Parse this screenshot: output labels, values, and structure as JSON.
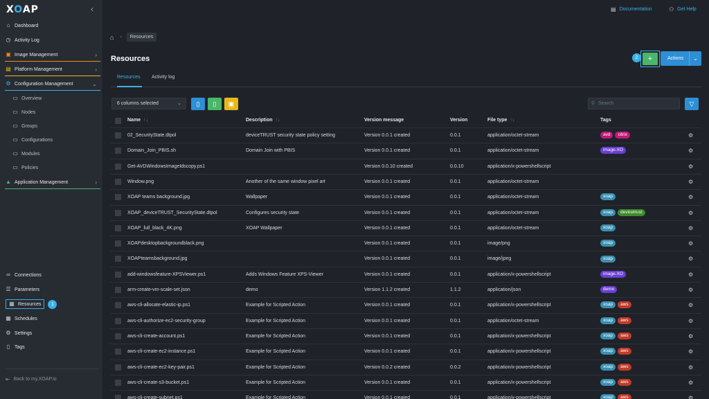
{
  "sidebar": {
    "logo": "XOAP",
    "items": [
      {
        "label": "Dashboard"
      },
      {
        "label": "Activity Log"
      },
      {
        "label": "Image Management"
      },
      {
        "label": "Platform Management"
      },
      {
        "label": "Configuration Management"
      },
      {
        "label": "Overview"
      },
      {
        "label": "Nodes"
      },
      {
        "label": "Groups"
      },
      {
        "label": "Configurations"
      },
      {
        "label": "Modules"
      },
      {
        "label": "Policies"
      },
      {
        "label": "Application Management"
      }
    ],
    "bottom": [
      {
        "label": "Connections"
      },
      {
        "label": "Parameters"
      },
      {
        "label": "Resources"
      },
      {
        "label": "Schedules"
      },
      {
        "label": "Settings"
      },
      {
        "label": "Tags"
      }
    ],
    "step_badge": "1",
    "back_link": "Back to my.XOAP.io",
    "colors": {
      "image": "#f08c1a",
      "platform": "#f0b61a",
      "config": "#3bb0e8",
      "app": "#4bb56a"
    }
  },
  "topbar": {
    "documentation": "Documentation",
    "help": "Get Help"
  },
  "breadcrumb": {
    "current": "Resources"
  },
  "page": {
    "title": "Resources",
    "step_badge": "2",
    "add_label": "+",
    "actions_label": "Actions",
    "tabs": [
      "Resources",
      "Activity log"
    ],
    "columns_selected": "6 columns selected",
    "search_placeholder": "Search"
  },
  "table": {
    "headers": [
      "Name",
      "Description",
      "Version message",
      "Version",
      "File type",
      "Tags"
    ],
    "rows": [
      {
        "name": "02_SecurityState.dtpol",
        "desc": "deviceTRUST security state policy setting",
        "msg": "Version 0.0.1 created",
        "ver": "0.0.1",
        "type": "application/octet-stream",
        "tags": [
          {
            "t": "avd",
            "c": "#c2187a"
          },
          {
            "t": "citrix",
            "c": "#c2187a"
          }
        ]
      },
      {
        "name": "Domain_Join_PBIS.sh",
        "desc": "Domain Join with PBIS",
        "msg": "Version 0.0.1 created",
        "ver": "0.0.1",
        "type": "application/octet-stream",
        "tags": [
          {
            "t": "image.XO",
            "c": "#6a3fd6"
          }
        ]
      },
      {
        "name": "Get-AVDWindowsImageIdscopy.ps1",
        "desc": "",
        "msg": "Version 0.0.10 created",
        "ver": "0.0.10",
        "type": "application/x-powershellscript",
        "tags": []
      },
      {
        "name": "Window.png",
        "desc": "Another of the same window pixel art",
        "msg": "Version 0.0.1 created",
        "ver": "0.0.1",
        "type": "application/octet-stream",
        "tags": []
      },
      {
        "name": "XOAP teams background.jpg",
        "desc": "Wallpaper",
        "msg": "Version 0.0.1 created",
        "ver": "0.0.1",
        "type": "application/octet-stream",
        "tags": [
          {
            "t": "xoap",
            "c": "#3a8fb0"
          }
        ]
      },
      {
        "name": "XOAP_deviceTRUST_SecurityState.dtpol",
        "desc": "Configures security state",
        "msg": "Version 0.0.1 created",
        "ver": "0.0.1",
        "type": "application/octet-stream",
        "tags": [
          {
            "t": "xoap",
            "c": "#3a8fb0"
          },
          {
            "t": "devicetrust",
            "c": "#3f8a2c"
          }
        ]
      },
      {
        "name": "XOAP_full_black_4K.png",
        "desc": "XOAP Wallpaper",
        "msg": "Version 0.0.1 created",
        "ver": "0.0.1",
        "type": "application/octet-stream",
        "tags": [
          {
            "t": "xoap",
            "c": "#3a8fb0"
          }
        ]
      },
      {
        "name": "XOAPdesktopbackgroundblack.png",
        "desc": "",
        "msg": "Version 0.0.1 created",
        "ver": "0.0.1",
        "type": "image/png",
        "tags": [
          {
            "t": "xoap",
            "c": "#3a8fb0"
          }
        ]
      },
      {
        "name": "XOAPteamsbackground.jpg",
        "desc": "",
        "msg": "Version 0.0.1 created",
        "ver": "0.0.1",
        "type": "image/jpeg",
        "tags": [
          {
            "t": "xoap",
            "c": "#3a8fb0"
          }
        ]
      },
      {
        "name": "add-windowsfeature-XPSViewer.ps1",
        "desc": "Adds Windows Feature XPS-Viewer",
        "msg": "Version 0.0.1 created",
        "ver": "0.0.1",
        "type": "application/x-powershellscript",
        "tags": [
          {
            "t": "image.XO",
            "c": "#6a3fd6"
          }
        ]
      },
      {
        "name": "arm-create-vm-scale-set.json",
        "desc": "demo",
        "msg": "Version 1.1.2 created",
        "ver": "1.1.2",
        "type": "application/json",
        "tags": [
          {
            "t": "demo",
            "c": "#6a3fd6"
          }
        ]
      },
      {
        "name": "aws-cli-allocate-elastic-ip.ps1",
        "desc": "Example for Scripted Action",
        "msg": "Version 0.0.1 created",
        "ver": "0.0.1",
        "type": "application/x-powershellscript",
        "tags": [
          {
            "t": "xoap",
            "c": "#3a8fb0"
          },
          {
            "t": "aws",
            "c": "#c23a2a"
          }
        ]
      },
      {
        "name": "aws-cli-authorize-ec2-security-group",
        "desc": "Example for Scripted Action",
        "msg": "Version 0.0.1 created",
        "ver": "0.0.1",
        "type": "application/octet-stream",
        "tags": [
          {
            "t": "xoap",
            "c": "#3a8fb0"
          },
          {
            "t": "aws",
            "c": "#c23a2a"
          }
        ]
      },
      {
        "name": "aws-cli-create-account.ps1",
        "desc": "Example for Scripted Action",
        "msg": "Version 0.0.1 created",
        "ver": "0.0.1",
        "type": "application/x-powershellscript",
        "tags": [
          {
            "t": "xoap",
            "c": "#3a8fb0"
          },
          {
            "t": "aws",
            "c": "#c23a2a"
          }
        ]
      },
      {
        "name": "aws-cli-create-ec2-instance.ps1",
        "desc": "Example for Scripted Action",
        "msg": "Version 0.0.1 created",
        "ver": "0.0.1",
        "type": "application/x-powershellscript",
        "tags": [
          {
            "t": "xoap",
            "c": "#3a8fb0"
          },
          {
            "t": "aws",
            "c": "#c23a2a"
          }
        ]
      },
      {
        "name": "aws-cli-create-ec2-key-pair.ps1",
        "desc": "Example for Scripted Action",
        "msg": "Version 0.0.2 created",
        "ver": "0.0.2",
        "type": "application/x-powershellscript",
        "tags": [
          {
            "t": "xoap",
            "c": "#3a8fb0"
          },
          {
            "t": "aws",
            "c": "#c23a2a"
          }
        ]
      },
      {
        "name": "aws-cli-create-s3-bucket.ps1",
        "desc": "Example for Scripted Action",
        "msg": "Version 0.0.1 created",
        "ver": "0.0.1",
        "type": "application/x-powershellscript",
        "tags": [
          {
            "t": "xoap",
            "c": "#3a8fb0"
          },
          {
            "t": "aws",
            "c": "#c23a2a"
          }
        ]
      },
      {
        "name": "aws-cli-create-subnet.ps1",
        "desc": "Example for Scripted Action",
        "msg": "Version 0.0.1 created",
        "ver": "0.0.1",
        "type": "application/x-powershellscript",
        "tags": [
          {
            "t": "xoap",
            "c": "#3a8fb0"
          },
          {
            "t": "aws",
            "c": "#c23a2a"
          }
        ]
      }
    ]
  }
}
